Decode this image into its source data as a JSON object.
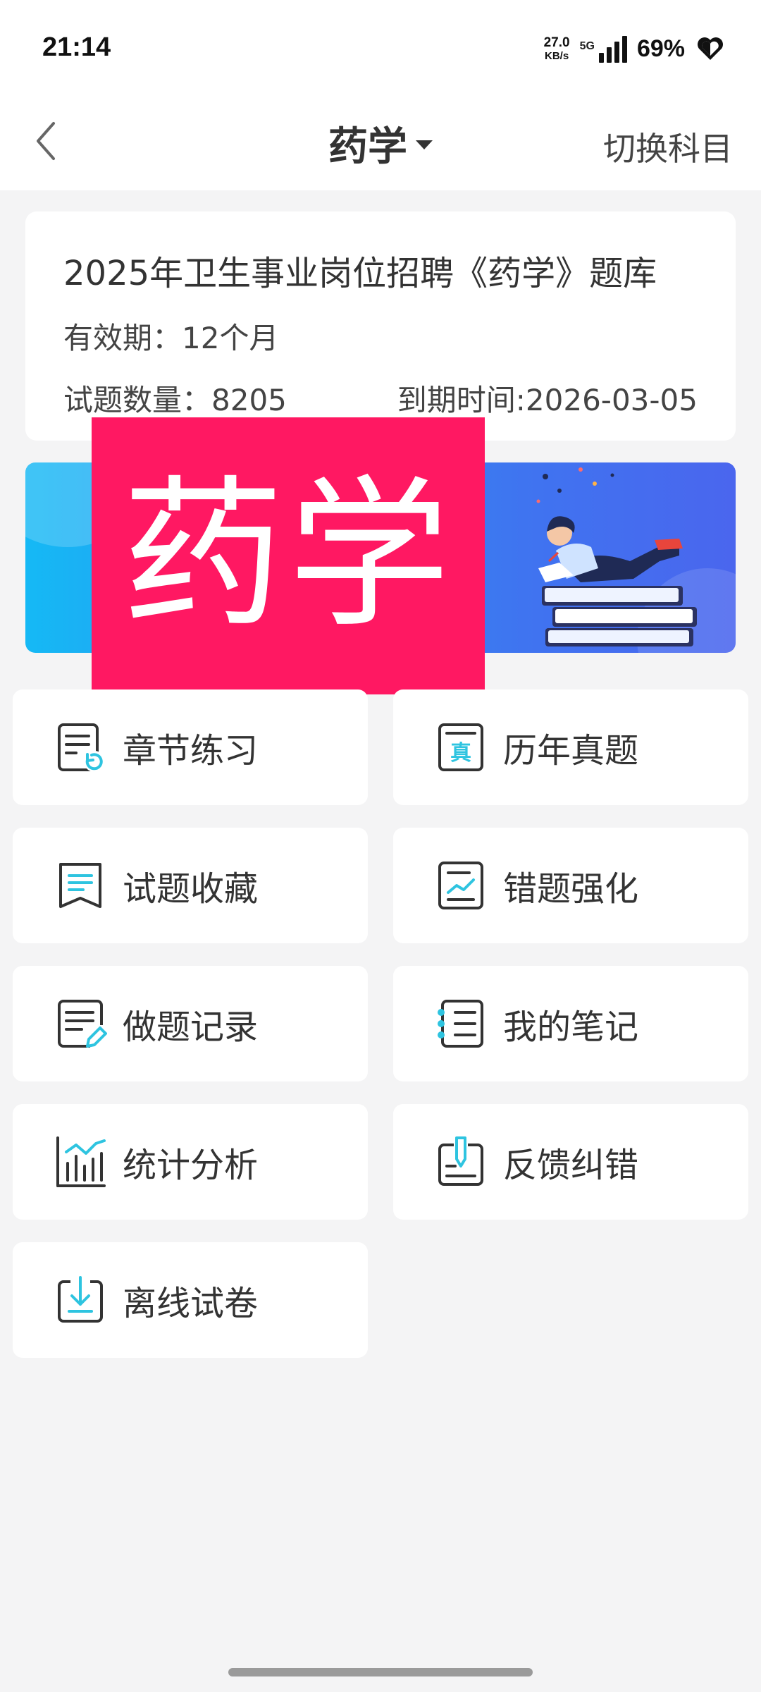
{
  "status_bar": {
    "time": "21:14",
    "net_speed_value": "27.0",
    "net_speed_unit": "KB/s",
    "network": "5G",
    "battery": "69%"
  },
  "nav": {
    "title": "药学",
    "switch_label": "切换科目"
  },
  "info": {
    "title": "2025年卫生事业岗位招聘《药学》题库",
    "validity": "有效期：12个月",
    "count": "试题数量：8205",
    "expire": "到期时间:2026-03-05"
  },
  "banner": {
    "overlay_text": "药学"
  },
  "menu": [
    {
      "label": "章节练习",
      "icon": "chapter-practice-icon"
    },
    {
      "label": "历年真题",
      "icon": "past-exam-icon"
    },
    {
      "label": "试题收藏",
      "icon": "bookmark-icon"
    },
    {
      "label": "错题强化",
      "icon": "wrong-question-icon"
    },
    {
      "label": "做题记录",
      "icon": "record-icon"
    },
    {
      "label": "我的笔记",
      "icon": "notes-icon"
    },
    {
      "label": "统计分析",
      "icon": "statistics-icon"
    },
    {
      "label": "反馈纠错",
      "icon": "feedback-icon"
    },
    {
      "label": "离线试卷",
      "icon": "download-icon"
    }
  ],
  "colors": {
    "accent": "#2ec4e0",
    "overlay": "#ff1862",
    "background": "#f4f4f5"
  }
}
